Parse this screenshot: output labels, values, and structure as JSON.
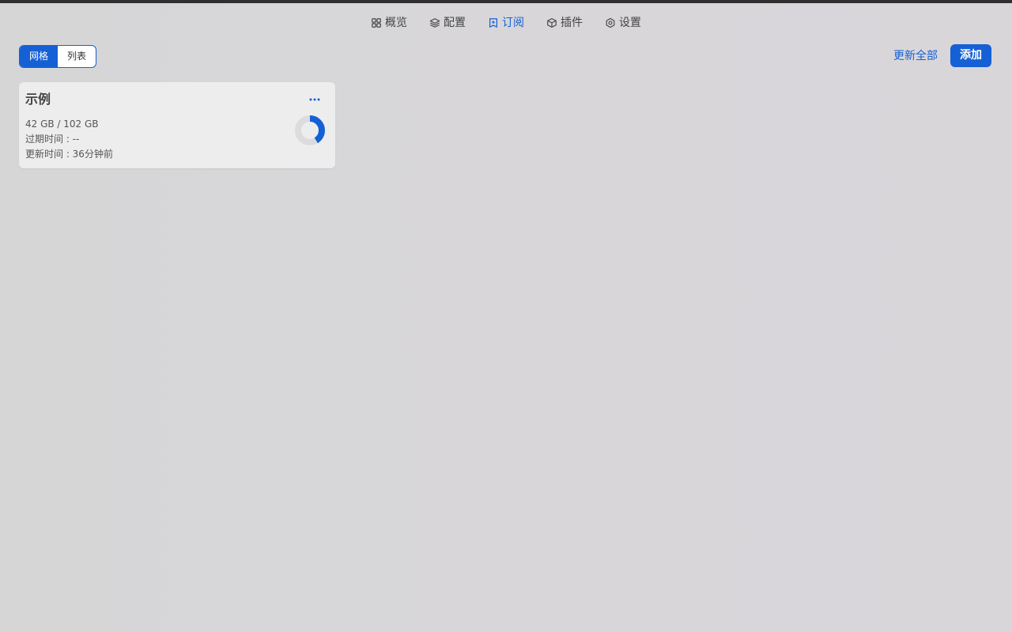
{
  "nav": {
    "items": [
      {
        "label": "概览",
        "icon": "grid-icon",
        "active": false
      },
      {
        "label": "配置",
        "icon": "layers-icon",
        "active": false
      },
      {
        "label": "订阅",
        "icon": "subscription-icon",
        "active": true
      },
      {
        "label": "插件",
        "icon": "cube-icon",
        "active": false
      },
      {
        "label": "设置",
        "icon": "gear-icon",
        "active": false
      }
    ]
  },
  "view_toggle": {
    "grid_label": "网格",
    "list_label": "列表",
    "selected": "grid"
  },
  "actions": {
    "update_all_label": "更新全部",
    "add_label": "添加"
  },
  "subscriptions": [
    {
      "name": "示例",
      "usage_text": "42 GB / 102 GB",
      "expire_text": "过期时间 : --",
      "updated_text": "更新时间 : 36分钟前",
      "usage_fraction": 0.4118
    }
  ],
  "colors": {
    "accent": "#1560d4",
    "donut_track": "#dcdcde"
  }
}
